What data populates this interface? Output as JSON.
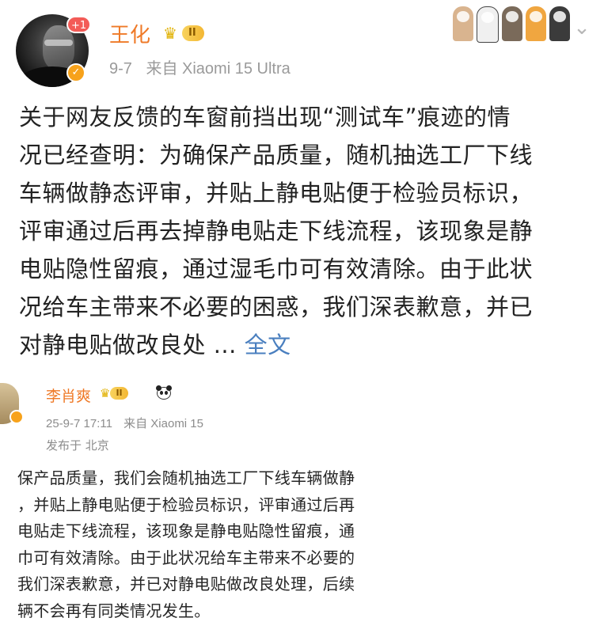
{
  "post": {
    "author": {
      "name": "王化",
      "notification_count": "+1",
      "level": "II",
      "verified_icon": "v-badge-icon"
    },
    "meta": {
      "date": "9-7",
      "source": "来自 Xiaomi 15 Ultra"
    },
    "body_lines": [
      "关于网友反馈的车窗前挡出现“测试车”痕迹的情",
      "况已经查明：为确保产品质量，随机抽选工厂下线",
      "车辆做静态评审，并贴上静电贴便于检验员标识，",
      "评审通过后再去掉静电贴走下线流程，该现象是静",
      "电贴隐性留痕，通过湿毛巾可有效清除。由于此状",
      "况给车主带来不必要的困惑，我们深表歉意，并已",
      "对静电贴做改良处 ..."
    ],
    "full_text_link": "全文",
    "decorations": [
      "paw-icon",
      "paw-icon",
      "paw-icon",
      "paw-icon",
      "paw-icon"
    ],
    "colors": {
      "name": "#ef7a28",
      "link": "#4a7fbf",
      "meta": "#9a9a9a",
      "text": "#222222",
      "badge": "#f35b57"
    }
  },
  "quoted": {
    "author": {
      "name": "李肖爽",
      "level": "II",
      "emoji": "panda-icon"
    },
    "meta": {
      "datetime": "25-9-7 17:11",
      "source": "来自 Xiaomi 15"
    },
    "location": "发布于 北京",
    "body_lines": [
      "保产品质量，我们会随机抽选工厂下线车辆做静",
      "，并贴上静电贴便于检验员标识，评审通过后再",
      "电贴走下线流程，该现象是静电贴隐性留痕，通",
      "巾可有效清除。由于此状况给车主带来不必要的",
      "我们深表歉意，并已对静电贴做改良处理，后续",
      "辆不会再有同类情况发生。"
    ]
  }
}
